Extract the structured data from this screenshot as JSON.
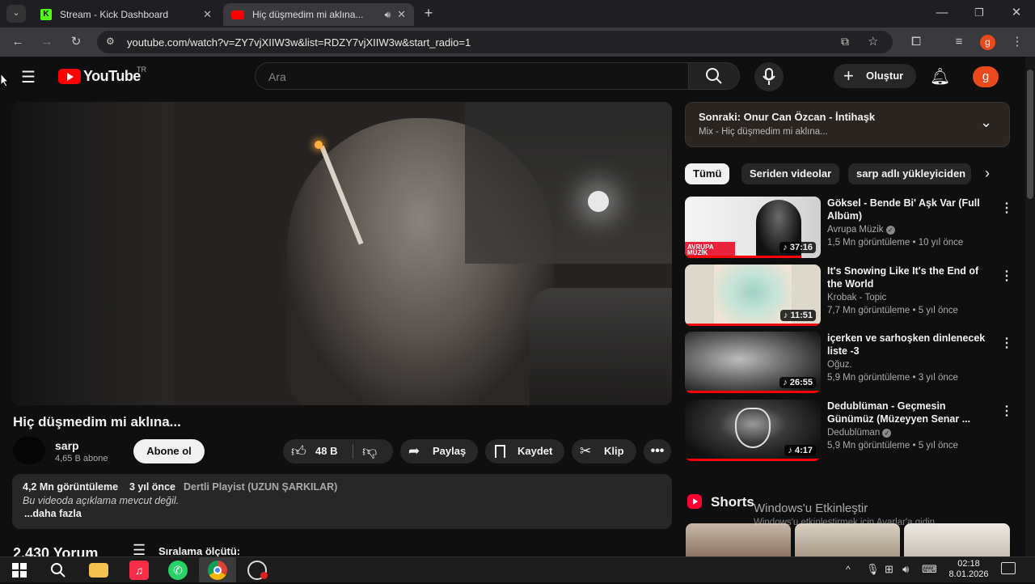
{
  "browser": {
    "tabs": [
      {
        "title": "Stream - Kick Dashboard",
        "favicon": "kick-icon"
      },
      {
        "title": "Hiç düşmedim mi aklına...",
        "favicon": "youtube-icon",
        "audio": true
      }
    ],
    "url": "youtube.com/watch?v=ZY7vjXIIW3w&list=RDZY7vjXIIW3w&start_radio=1",
    "profile_initial": "g"
  },
  "youtube": {
    "logo": "YouTube",
    "region": "TR",
    "search_placeholder": "Ara",
    "create_label": "Oluştur",
    "avatar_initial": "g"
  },
  "video": {
    "title": "Hiç düşmedim mi aklına...",
    "channel": "sarp",
    "subscribers": "4,65 B abone",
    "subscribe_label": "Abone ol",
    "likes": "48 B",
    "share_label": "Paylaş",
    "save_label": "Kaydet",
    "clip_label": "Klip"
  },
  "description": {
    "views": "4,2 Mn görüntüleme",
    "age": "3 yıl önce",
    "playlist": "Dertli Playist (UZUN ŞARKILAR)",
    "text": "Bu videoda açıklama mevcut değil.",
    "more_label": "...daha fazla"
  },
  "comments": {
    "count": "2.430 Yorum",
    "sort_label": "Sıralama ölçütü:"
  },
  "up_next": {
    "title": "Sonraki: Onur Can Özcan - İntihaşk",
    "subtitle": "Mix - Hiç düşmedim mi aklına..."
  },
  "chips": [
    "Tümü",
    "Seriden videolar",
    "sarp adlı yükleyiciden"
  ],
  "recommendations": [
    {
      "title": "Göksel - Bende Bi' Aşk Var (Full Albüm)",
      "channel": "Avrupa Müzik",
      "verified": true,
      "meta": "1,5 Mn görüntüleme • 10 yıl önce",
      "duration": "37:16",
      "thumb_text": "AVRUPA MÜZİK"
    },
    {
      "title": "It's Snowing Like It's the End of the World",
      "channel": "Krobak - Topic",
      "verified": false,
      "meta": "7,7 Mn görüntüleme • 5 yıl önce",
      "duration": "11:51"
    },
    {
      "title": "içerken ve sarhoşken dinlenecek liste -3",
      "channel": "Oğuz.",
      "verified": false,
      "meta": "5,9 Mn görüntüleme • 3 yıl önce",
      "duration": "26:55"
    },
    {
      "title": "Dedublüman - Geçmesin Günümüz (Müzeyyen Senar ...",
      "channel": "Dedublüman",
      "verified": true,
      "meta": "5,9 Mn görüntüleme • 5 yıl önce",
      "duration": "4:17"
    }
  ],
  "shorts_label": "Shorts",
  "watermark": {
    "line1": "Windows'u Etkinleştir",
    "line2": "Windows'u etkinleştirmek için Ayarlar'a gidin."
  },
  "taskbar": {
    "time": "02:18",
    "date": "8.01.2026"
  },
  "colors": {
    "accent": "#ff0000",
    "background": "#0f0f0f",
    "avatar": "#e8491d"
  }
}
